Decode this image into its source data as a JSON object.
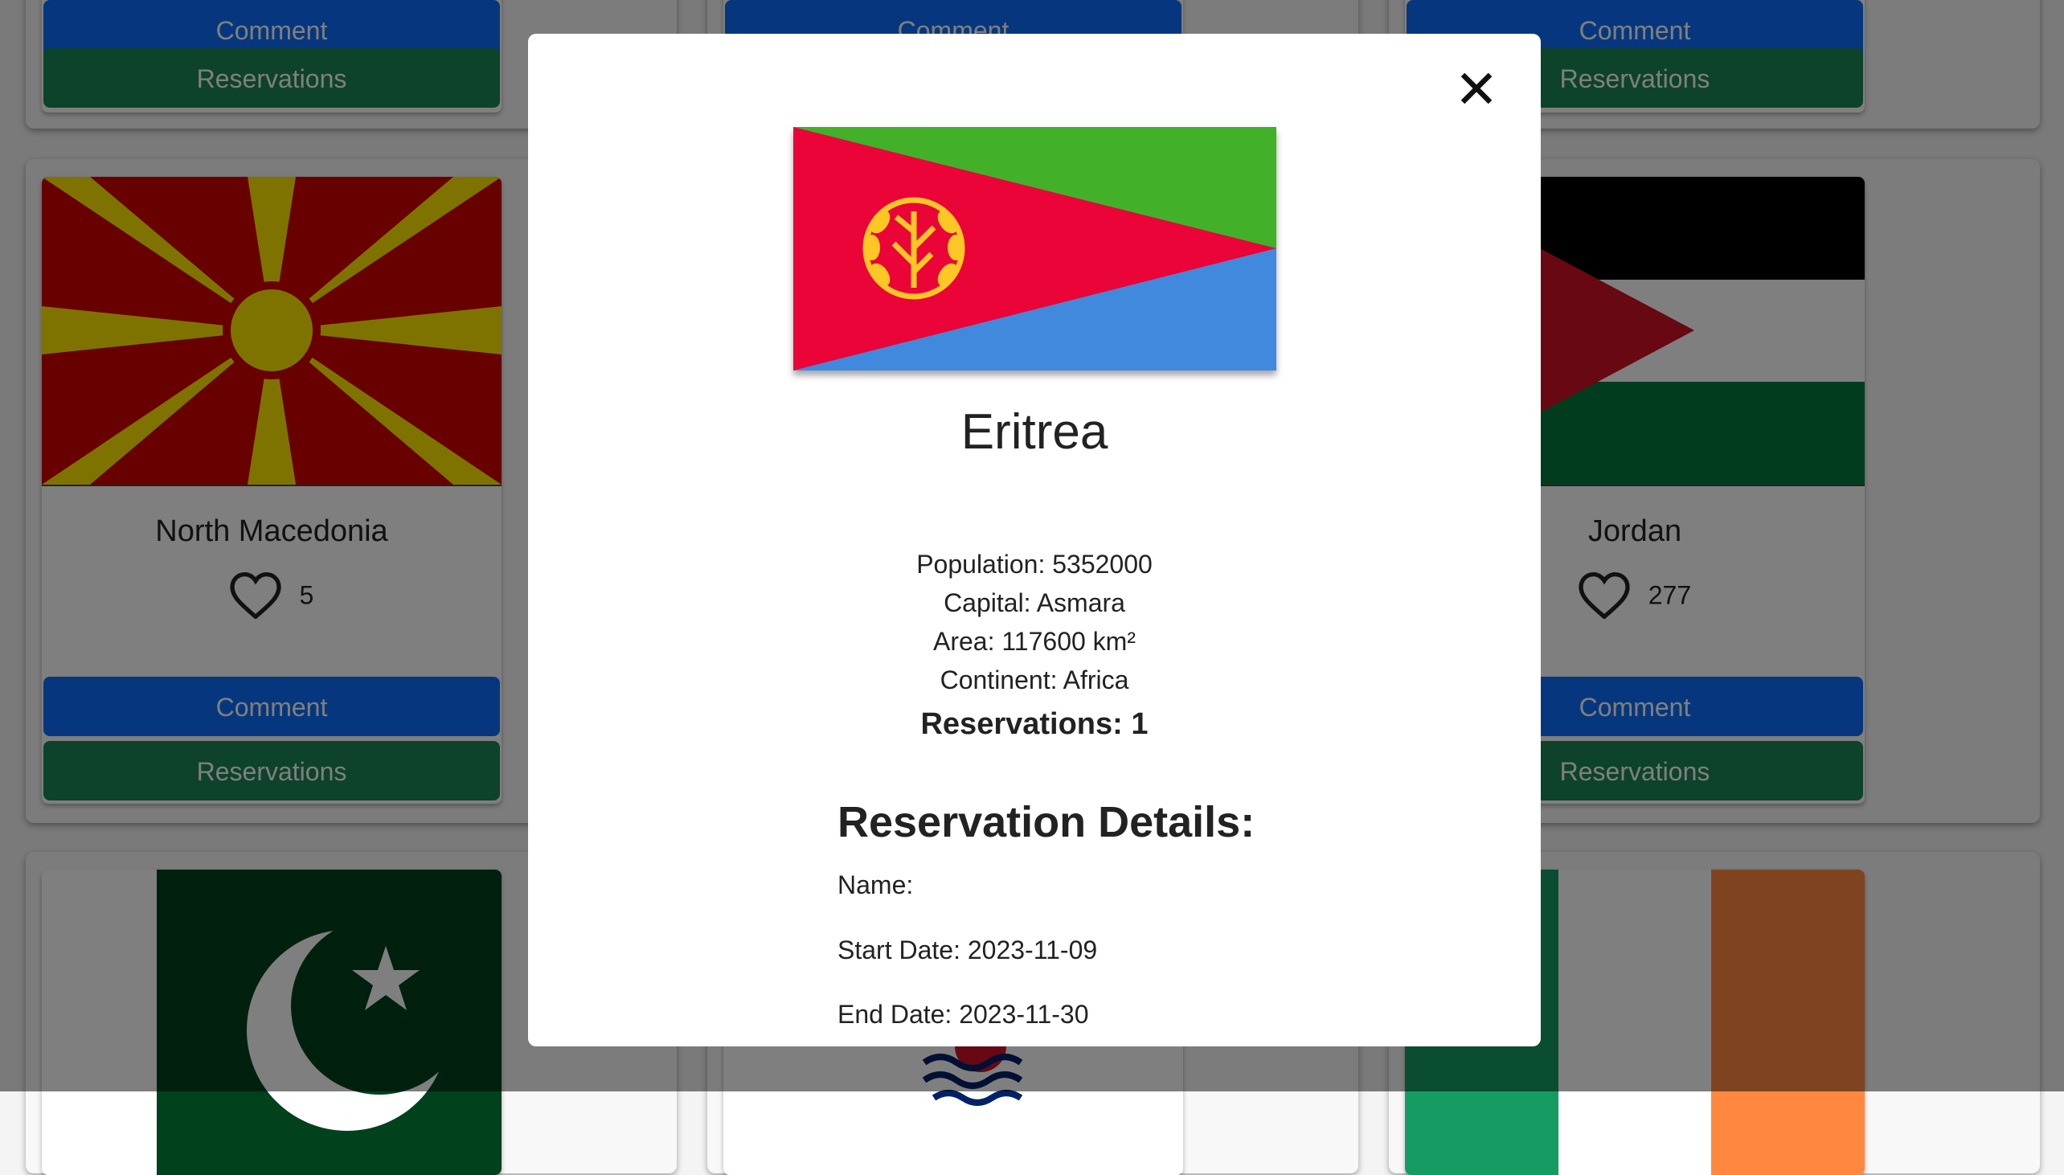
{
  "cards": {
    "top_left": {
      "comment": "Comment",
      "reservations": "Reservations"
    },
    "top_mid": {
      "comment": "Comment"
    },
    "top_right": {
      "comment": "Comment",
      "reservations": "Reservations"
    },
    "mid_left": {
      "name": "North Macedonia",
      "likes": "5",
      "comment": "Comment",
      "reservations": "Reservations"
    },
    "mid_right": {
      "name": "Jordan",
      "likes": "277",
      "comment": "Comment",
      "reservations": "Reservations"
    }
  },
  "modal": {
    "country": "Eritrea",
    "population": "Population: 5352000",
    "capital": "Capital: Asmara",
    "area": "Area: 117600 km²",
    "continent": "Continent: Africa",
    "reservations_count": "Reservations: 1",
    "details_heading": "Reservation Details:",
    "name_label": "Name:",
    "start_date": "Start Date: 2023-11-09",
    "end_date": "End Date: 2023-11-30"
  },
  "icons": {
    "close": "close-icon",
    "like": "heart-icon"
  },
  "colors": {
    "comment_button": "#0d6efd",
    "reservation_button": "#198754"
  }
}
